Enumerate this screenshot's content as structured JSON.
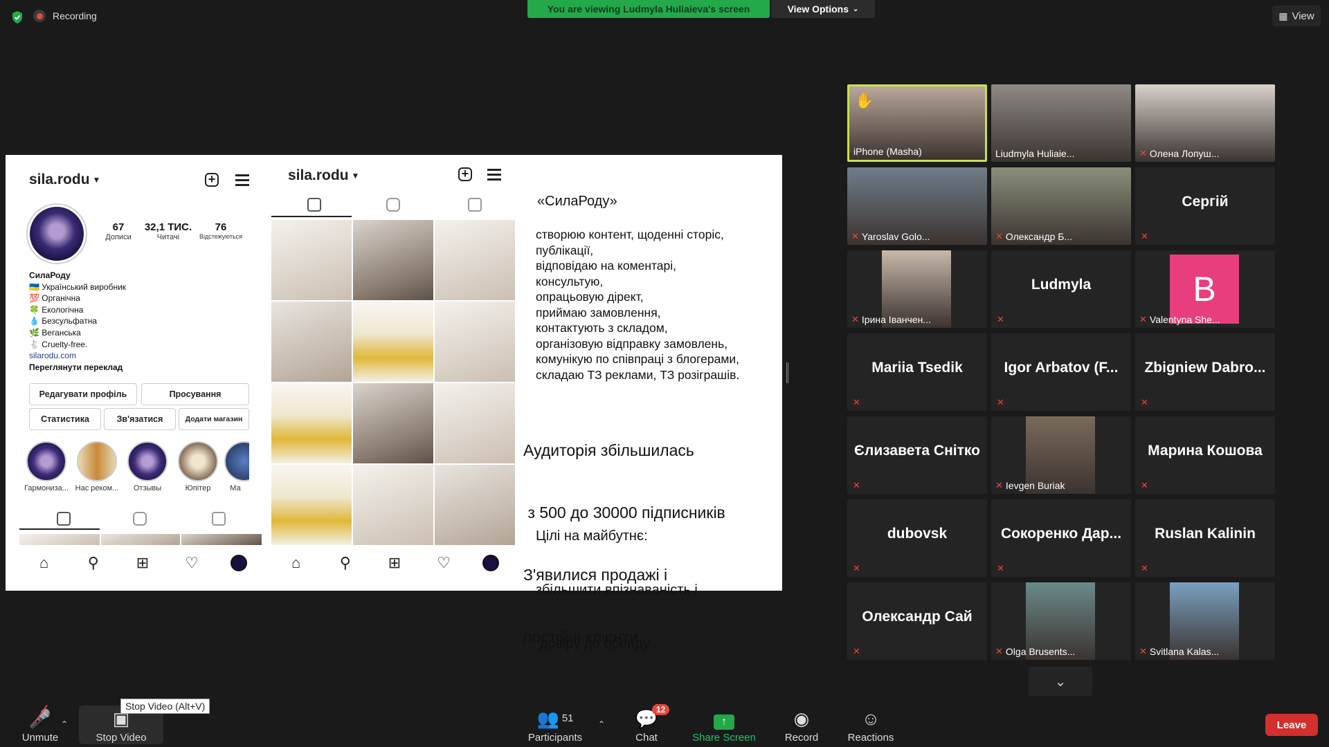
{
  "top": {
    "recording_label": "Recording",
    "viewing_banner": "You are viewing Ludmyla Huliaieva's screen",
    "view_options": "View Options",
    "view_label": "View"
  },
  "slide": {
    "left_profile": {
      "username": "sila.rodu",
      "stats": [
        {
          "value": "67",
          "label": "Дописи"
        },
        {
          "value": "32,1 ТИС.",
          "label": "Читачі"
        },
        {
          "value": "76",
          "label": "Відстежуються"
        }
      ],
      "bio_lines": [
        "СилаРоду",
        "🇺🇦 Український виробник",
        "💯 Органічна",
        "🍀 Екологічна",
        "💧 Безсульфатна",
        "🌿 Веганська",
        "🐇 Cruelty-free."
      ],
      "link": "silarodu.com",
      "translate": "Переглянути переклад",
      "buttons": [
        "Редагувати профіль",
        "Просування",
        "Статистика",
        "Зв'язатися",
        "Додати магазин"
      ],
      "highlights": [
        "Гармониза...",
        "Нас реком...",
        "Отзывы",
        "Юпітер",
        "Ма"
      ]
    },
    "right_profile": {
      "username": "sila.rodu"
    },
    "text": {
      "title": "«СилаРоду»",
      "duties": [
        "створюю контент, щоденні сторіс,",
        "публікації,",
        "відповідаю на коментарі,",
        "консультую,",
        "опрацьовую дірект,",
        "приймаю замовлення,",
        "контактують з складом,",
        "організовую відправку замовлень,",
        "комунікую по співпраці з блогерами,",
        "складаю ТЗ реклами, ТЗ розіграшів."
      ],
      "results": [
        "Аудиторія збільшилась",
        " з 500 до 30000 підписників",
        "З'явилися продажі і",
        "постійні клієнти"
      ],
      "goals": [
        "Цілі на майбутнє:",
        "збільшити впізнаваність і",
        " довіру до бренду"
      ]
    }
  },
  "participants": [
    {
      "name": "iPhone (Masha)",
      "type": "video",
      "active": true,
      "hand": true
    },
    {
      "name": "Liudmyla Huliaie...",
      "type": "video"
    },
    {
      "name": "Олена Лопуш...",
      "type": "video",
      "muted": true
    },
    {
      "name": "Yaroslav Golo...",
      "type": "video",
      "muted": true
    },
    {
      "name": "Олександр Б...",
      "type": "video",
      "muted": true
    },
    {
      "name": "Сергій",
      "type": "name",
      "muted": true
    },
    {
      "name": "Ірина Іванчен...",
      "type": "video",
      "muted": true
    },
    {
      "name": "Ludmyla",
      "type": "name",
      "muted": true
    },
    {
      "name": "Valentyna She...",
      "type": "letter",
      "letter": "B",
      "muted": true
    },
    {
      "name": "Mariia Tsedik",
      "type": "name",
      "muted": true
    },
    {
      "name": "Igor Arbatov (F...",
      "type": "name",
      "muted": true
    },
    {
      "name": "Zbigniew Dabro...",
      "type": "name",
      "muted": true
    },
    {
      "name": "Єлизавета Снітко",
      "type": "name",
      "muted": true
    },
    {
      "name": "Ievgen Buriak",
      "type": "video",
      "muted": true
    },
    {
      "name": "Марина Кошова",
      "type": "name",
      "muted": true
    },
    {
      "name": "dubovsk",
      "type": "name",
      "muted": true
    },
    {
      "name": "Сокоренко Дар...",
      "type": "name",
      "muted": true
    },
    {
      "name": "Ruslan Kalinin",
      "type": "name",
      "muted": true
    },
    {
      "name": "Олександр Сай",
      "type": "name",
      "muted": true
    },
    {
      "name": "Olga Brusents...",
      "type": "video",
      "muted": true
    },
    {
      "name": "Svitlana Kalas...",
      "type": "video",
      "muted": true
    }
  ],
  "bottom": {
    "unmute": "Unmute",
    "stop_video": "Stop Video",
    "tooltip": "Stop Video (Alt+V)",
    "participants": "Participants",
    "participants_count": "51",
    "chat": "Chat",
    "chat_badge": "12",
    "share_screen": "Share Screen",
    "record": "Record",
    "reactions": "Reactions",
    "leave": "Leave"
  },
  "colors": {
    "active_border": "#c8e04f",
    "banner": "#23a94a",
    "leave": "#d32f2f",
    "muted": "#e5483f",
    "letter_tile": "#e83e7d"
  }
}
